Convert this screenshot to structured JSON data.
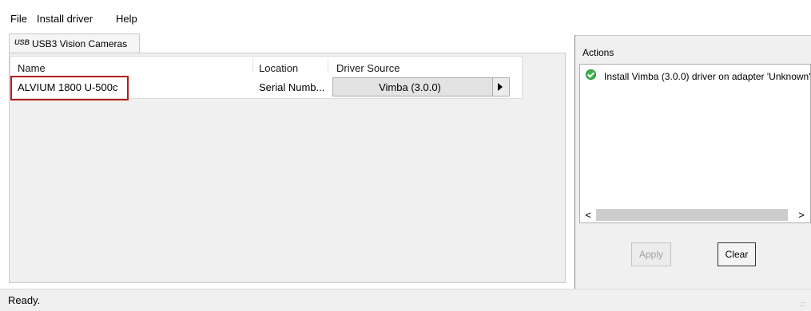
{
  "menu": {
    "file": "File",
    "install_driver": "Install driver",
    "help": "Help"
  },
  "tab": {
    "icon": "usb-icon",
    "icon_text": "USB",
    "label": "USB3 Vision Cameras"
  },
  "table": {
    "columns": [
      "Name",
      "Location",
      "Driver Source"
    ],
    "rows": [
      {
        "name": "ALVIUM 1800 U-500c",
        "location": "Serial Numb...",
        "driver_source": "Vimba (3.0.0)"
      }
    ]
  },
  "actions": {
    "title": "Actions",
    "items": [
      {
        "icon": "check-circle-icon",
        "text": "Install Vimba (3.0.0) driver on adapter 'Unknown'"
      }
    ],
    "scroll_left": "<",
    "scroll_right": ">"
  },
  "buttons": {
    "apply": "Apply",
    "clear": "Clear"
  },
  "status": {
    "text": "Ready.",
    "grip": ".::"
  },
  "colors": {
    "highlight": "#b01e1e",
    "success": "#3ab54a"
  }
}
